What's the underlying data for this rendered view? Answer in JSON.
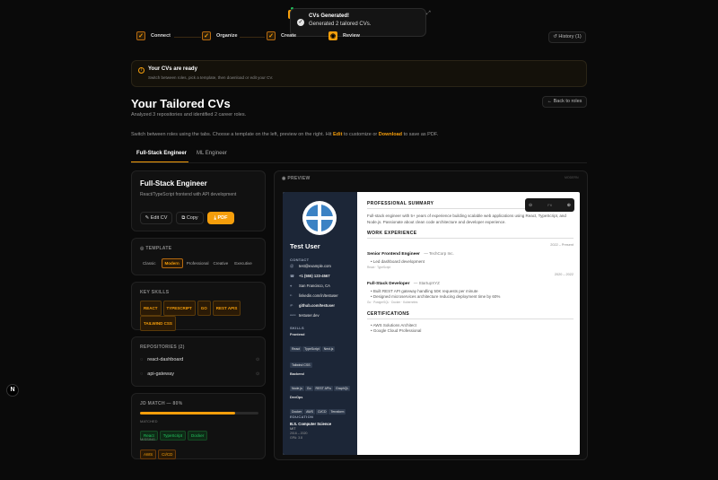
{
  "toast": {
    "title": "CVs Generated!",
    "message": "Generated 2 tailored CVs."
  },
  "steps": [
    {
      "label": "Connect"
    },
    {
      "label": "Organize"
    },
    {
      "label": "Create"
    },
    {
      "label": "Review"
    }
  ],
  "history_label": "History (1)",
  "banner": {
    "title": "Your CVs are ready",
    "subtitle": "Switch between roles, pick a template, then download or edit your CV."
  },
  "page": {
    "title": "Your Tailored CVs",
    "subtitle": "Analyzed 3 repositories and identified 2 career roles.",
    "back_label": "Back to roles",
    "instructions_pre": "Switch between roles using the tabs. Choose a template on the left, preview on the right. Hit ",
    "instructions_edit": "Edit",
    "instructions_mid": " to customize or ",
    "instructions_download": "Download",
    "instructions_post": " to save as PDF."
  },
  "tabs": [
    {
      "label": "Full-Stack Engineer"
    },
    {
      "label": "ML Engineer"
    }
  ],
  "role": {
    "title": "Full-Stack Engineer",
    "subtitle": "React/TypeScript frontend with API development",
    "edit_label": "Edit CV",
    "copy_label": "Copy",
    "pdf_label": "PDF"
  },
  "template": {
    "heading": "TEMPLATE",
    "options": [
      "Classic",
      "Modern",
      "Professional",
      "Creative",
      "Executive"
    ]
  },
  "key_skills": {
    "heading": "KEY SKILLS",
    "items": [
      "REACT",
      "TYPESCRIPT",
      "GO",
      "REST APIS",
      "TAILWIND CSS"
    ]
  },
  "repositories": {
    "heading": "REPOSITORIES (2)",
    "items": [
      "react-dashboard",
      "api-gateway"
    ]
  },
  "jd_match": {
    "heading": "JD MATCH — 80%",
    "percent": 80,
    "matched_label": "MATCHED",
    "matched": [
      "React",
      "TypeScript",
      "Docker"
    ],
    "missing_label": "MISSING",
    "missing": [
      "AWS",
      "CI/CD"
    ]
  },
  "preview": {
    "heading": "PREVIEW",
    "zoom": "Fit"
  },
  "cv": {
    "name": "Test User",
    "contact_heading": "CONTACT",
    "contact": [
      {
        "icon": "@",
        "text": "test@example.com"
      },
      {
        "icon": "☎",
        "text": "+1 (555) 123-4567"
      },
      {
        "icon": "⌖",
        "text": "San Francisco, CA"
      },
      {
        "icon": "in",
        "text": "linkedin.com/in/testuser"
      },
      {
        "icon": "gh",
        "text": "github.com/testuser"
      },
      {
        "icon": "www",
        "text": "testuser.dev"
      }
    ],
    "skills_heading": "SKILLS",
    "skill_groups": [
      {
        "name": "Frontend",
        "items": [
          "React",
          "TypeScript",
          "Next.js",
          "Tailwind CSS"
        ]
      },
      {
        "name": "Backend",
        "items": [
          "Node.js",
          "Go",
          "REST APIs",
          "GraphQL"
        ]
      },
      {
        "name": "DevOps",
        "items": [
          "Docker",
          "AWS",
          "CI/CD",
          "Terraform"
        ]
      }
    ],
    "education_heading": "EDUCATION",
    "education": {
      "degree": "B.S. Computer Science",
      "school": "MIT",
      "years": "2016 – 2020",
      "gpa": "GPA: 3.8"
    },
    "summary_heading": "PROFESSIONAL SUMMARY",
    "summary": "Full-stack engineer with 5+ years of experience building scalable web applications using React, TypeScript, and Node.js. Passionate about clean code architecture and developer experience.",
    "experience_heading": "WORK EXPERIENCE",
    "jobs": [
      {
        "title": "Senior Frontend Engineer",
        "company": "— TechCorp Inc.",
        "dates": "2022 – Present",
        "bullets": [
          "Led dashboard development"
        ],
        "tags": "React · TypeScript"
      },
      {
        "title": "Full-Stack Developer",
        "company": "— StartupXYZ",
        "dates": "2020 – 2022",
        "bullets": [
          "Built REST API gateway handling 50K requests per minute",
          "Designed microservices architecture reducing deployment time by 60%"
        ],
        "tags": "Go · PostgreSQL · Docker · Kubernetes"
      }
    ],
    "cert_heading": "CERTIFICATIONS",
    "certs": [
      "AWS Solutions Architect",
      "Google Cloud Professional"
    ]
  },
  "colors": {
    "accent": "#f59e0b",
    "bg": "#0a0a0a",
    "cv_sidebar": "#1c2637"
  }
}
